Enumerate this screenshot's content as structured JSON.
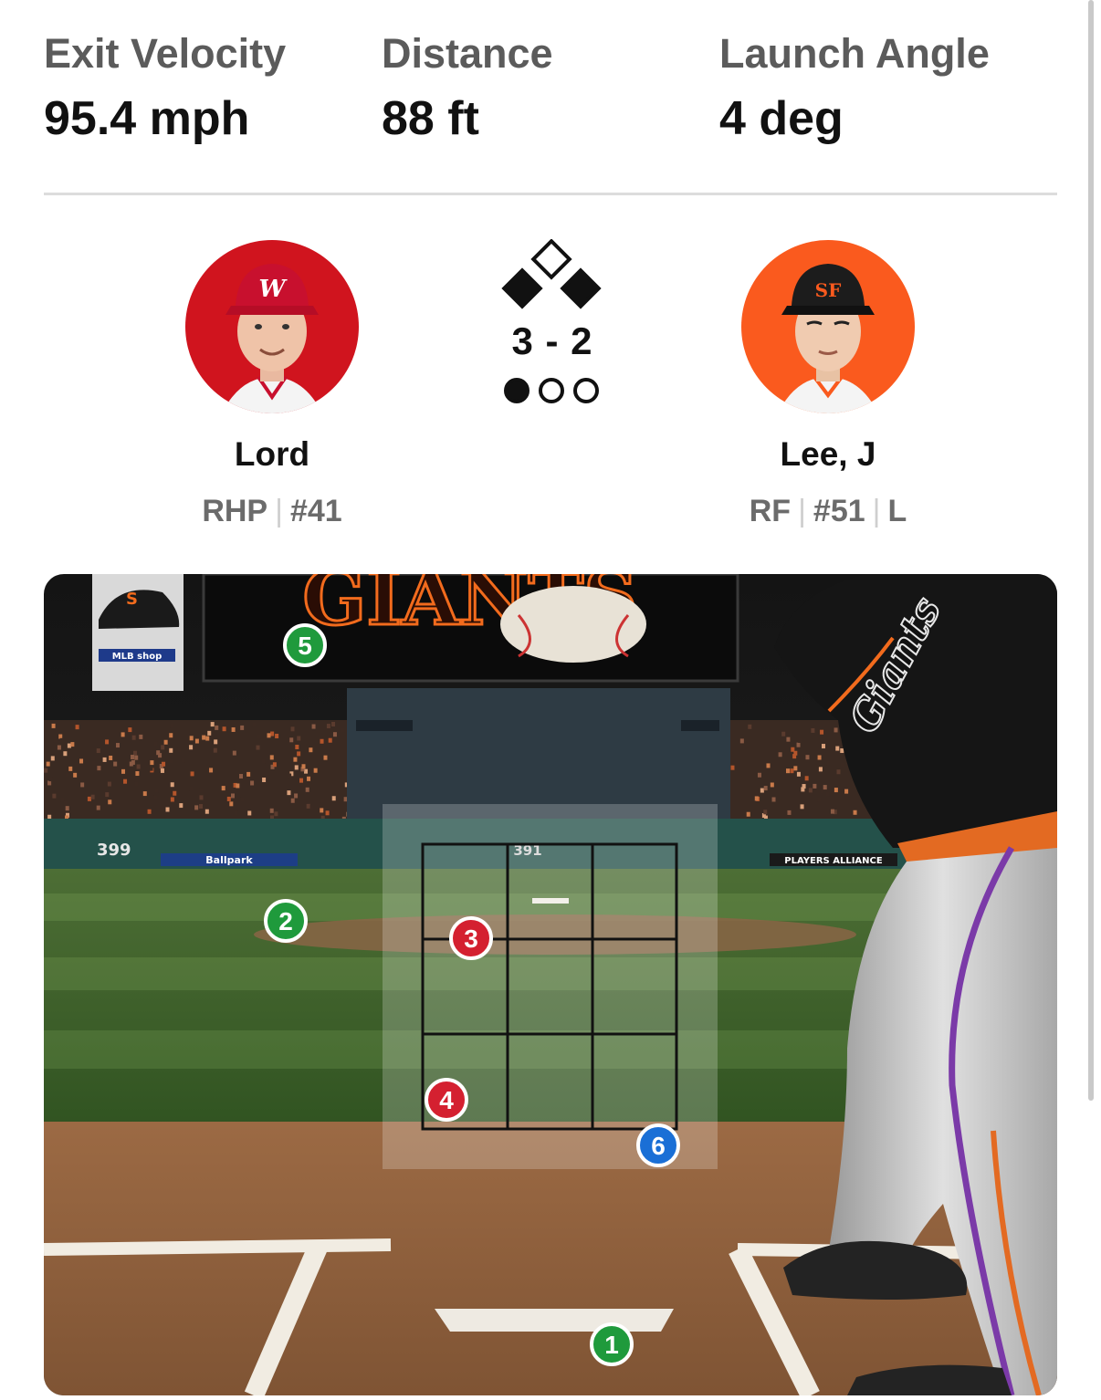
{
  "stats": {
    "exit_velocity": {
      "label": "Exit Velocity",
      "value": "95.4 mph"
    },
    "distance": {
      "label": "Distance",
      "value": "88 ft"
    },
    "launch_angle": {
      "label": "Launch Angle",
      "value": "4 deg"
    }
  },
  "pitcher": {
    "name": "Lord",
    "position": "RHP",
    "number": "#41",
    "team_color": "#d0141e",
    "cap_logo": "W"
  },
  "batter": {
    "name": "Lee, J",
    "position": "RF",
    "number": "#51",
    "bats": "L",
    "team_color": "#fa5a1e",
    "cap_logo": "SF"
  },
  "situation": {
    "count": "3 - 2",
    "bases": {
      "first": true,
      "second": false,
      "third": true
    },
    "outs": 1,
    "outs_total": 3
  },
  "field": {
    "scoreboard_text": "GIANTS",
    "wall_distance": "399",
    "center_wall": "391",
    "ad_left": "Ballpark",
    "ad_right": "PLAYERS ALLIANCE",
    "shop_sign": "MLB shop",
    "jersey_text": "Giants"
  },
  "pitches": [
    {
      "n": "1",
      "result": "ball",
      "color": "#1f9a3c"
    },
    {
      "n": "2",
      "result": "ball",
      "color": "#1f9a3c"
    },
    {
      "n": "3",
      "result": "strike",
      "color": "#d42030"
    },
    {
      "n": "4",
      "result": "strike",
      "color": "#d42030"
    },
    {
      "n": "5",
      "result": "ball",
      "color": "#1f9a3c"
    },
    {
      "n": "6",
      "result": "in-play",
      "color": "#1a6fd6"
    }
  ]
}
